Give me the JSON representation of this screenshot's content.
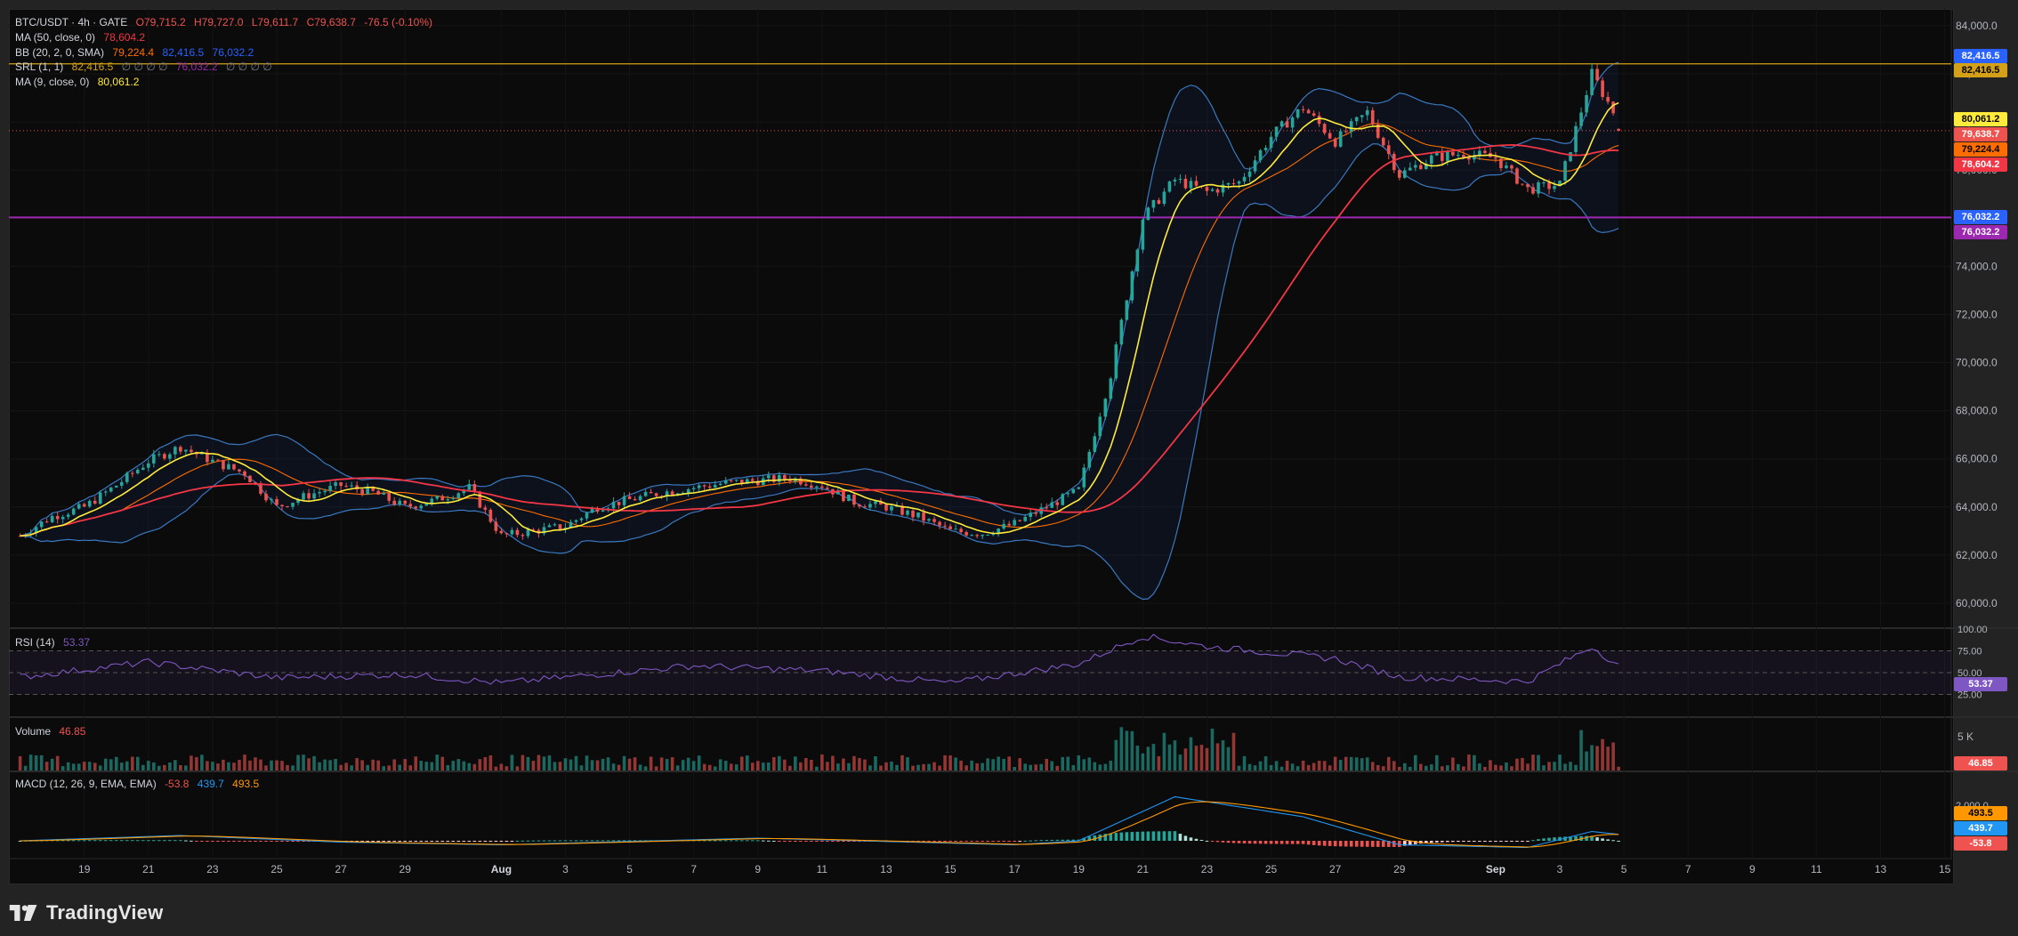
{
  "legend": {
    "symbol": "BTC/USDT · 4h · GATE",
    "o": "O79,715.2",
    "h": "H79,727.0",
    "l": "L79,611.7",
    "c": "C79,638.7",
    "chg": "-76.5 (-0.10%)",
    "ma50_label": "MA (50, close, 0)",
    "ma50_value": "78,604.2",
    "bb_label": "BB (20, 2, 0, SMA)",
    "bb_basis": "79,224.4",
    "bb_upper": "82,416.5",
    "bb_lower": "76,032.2",
    "srl_label": "SRL (1, 1)",
    "srl_upper": "82,416.5",
    "srl_zeros_a": "∅ ∅ ∅ ∅",
    "srl_lower": "76,032.2",
    "srl_zeros_b": "∅ ∅ ∅ ∅",
    "ma9_label": "MA (9, close, 0)",
    "ma9_value": "80,061.2",
    "rsi_label": "RSI (14)",
    "rsi_value": "53.37",
    "vol_label": "Volume",
    "vol_value": "46.85",
    "macd_label": "MACD (12, 26, 9, EMA, EMA)",
    "macd_hist": "-53.8",
    "macd_line": "439.7",
    "macd_signal": "493.5"
  },
  "colors": {
    "up": "#26a69a",
    "down": "#ef5350",
    "ma9": "#ffeb3b",
    "ma50": "#f23645",
    "bb_basis": "#ff6d00",
    "bb_band": "#2962ff",
    "srl_upper": "#d4a017",
    "srl_lower": "#9c27b0",
    "rsi": "#7e57c2",
    "macd": "#2196f3",
    "signal": "#ff9800"
  },
  "price_axis": [
    "84,000.0",
    "82,000.0",
    "80,000.0",
    "78,000.0",
    "76,000.0",
    "74,000.0",
    "72,000.0",
    "70,000.0",
    "68,000.0",
    "66,000.0",
    "64,000.0",
    "62,000.0",
    "60,000.0"
  ],
  "rsi_axis": [
    "100.00",
    "75.00",
    "50.00",
    "25.00"
  ],
  "vol_axis": [
    "5 K"
  ],
  "macd_axis": [
    "2,000.0"
  ],
  "price_labels": {
    "bb_upper": "82,416.5",
    "srl_upper": "82,416.5",
    "ma9": "80,061.2",
    "last": "79,638.7",
    "basis": "79,224.4",
    "ma50": "78,604.2",
    "bb_lower": "76,032.2",
    "srl_lower": "76,032.2",
    "rsi": "53.37",
    "vol": "46.85",
    "signal": "493.5",
    "macd": "439.7",
    "hist": "-53.8"
  },
  "time_axis": [
    "19",
    "21",
    "23",
    "25",
    "27",
    "29",
    "Aug",
    "3",
    "5",
    "7",
    "9",
    "11",
    "13",
    "15",
    "17",
    "19",
    "21",
    "23",
    "25",
    "27",
    "29",
    "Sep",
    "3",
    "5",
    "7",
    "9",
    "11",
    "13",
    "15"
  ],
  "brand": "TradingView",
  "chart_data": {
    "type": "candlestick",
    "symbol": "BTC/USDT",
    "timeframe": "4h",
    "exchange": "GATE",
    "ohlc_last": {
      "open": 79715.2,
      "high": 79727.0,
      "low": 79611.7,
      "close": 79638.7
    },
    "change": -76.5,
    "change_pct": -0.1,
    "ylim": [
      59000,
      84700
    ],
    "close_path": [
      {
        "date": "Jul 17",
        "close": 62800
      },
      {
        "date": "Jul 18",
        "close": 63600
      },
      {
        "date": "Jul 19",
        "close": 64000
      },
      {
        "date": "Jul 20",
        "close": 64900
      },
      {
        "date": "Jul 21",
        "close": 65900
      },
      {
        "date": "Jul 22",
        "close": 66500
      },
      {
        "date": "Jul 23",
        "close": 65900
      },
      {
        "date": "Jul 24",
        "close": 65400
      },
      {
        "date": "Jul 25",
        "close": 64000
      },
      {
        "date": "Jul 26",
        "close": 64500
      },
      {
        "date": "Jul 27",
        "close": 64900
      },
      {
        "date": "Jul 28",
        "close": 64600
      },
      {
        "date": "Jul 29",
        "close": 64000
      },
      {
        "date": "Jul 30",
        "close": 64300
      },
      {
        "date": "Jul 31",
        "close": 64800
      },
      {
        "date": "Aug 1",
        "close": 62800
      },
      {
        "date": "Aug 2",
        "close": 63000
      },
      {
        "date": "Aug 3",
        "close": 63200
      },
      {
        "date": "Aug 4",
        "close": 64000
      },
      {
        "date": "Aug 5",
        "close": 64300
      },
      {
        "date": "Aug 6",
        "close": 64600
      },
      {
        "date": "Aug 7",
        "close": 64800
      },
      {
        "date": "Aug 8",
        "close": 65000
      },
      {
        "date": "Aug 9",
        "close": 65100
      },
      {
        "date": "Aug 10",
        "close": 65200
      },
      {
        "date": "Aug 11",
        "close": 64900
      },
      {
        "date": "Aug 12",
        "close": 64200
      },
      {
        "date": "Aug 13",
        "close": 64000
      },
      {
        "date": "Aug 14",
        "close": 63600
      },
      {
        "date": "Aug 15",
        "close": 63000
      },
      {
        "date": "Aug 16",
        "close": 62900
      },
      {
        "date": "Aug 17",
        "close": 63300
      },
      {
        "date": "Aug 18",
        "close": 64000
      },
      {
        "date": "Aug 19",
        "close": 64700
      },
      {
        "date": "Aug 20",
        "close": 69500
      },
      {
        "date": "Aug 21",
        "close": 76000
      },
      {
        "date": "Aug 22",
        "close": 77600
      },
      {
        "date": "Aug 23",
        "close": 77100
      },
      {
        "date": "Aug 24",
        "close": 77500
      },
      {
        "date": "Aug 25",
        "close": 79400
      },
      {
        "date": "Aug 26",
        "close": 80600
      },
      {
        "date": "Aug 27",
        "close": 79200
      },
      {
        "date": "Aug 28",
        "close": 80400
      },
      {
        "date": "Aug 29",
        "close": 77800
      },
      {
        "date": "Aug 30",
        "close": 78500
      },
      {
        "date": "Aug 31",
        "close": 78700
      },
      {
        "date": "Sep 1",
        "close": 78500
      },
      {
        "date": "Sep 2",
        "close": 77200
      },
      {
        "date": "Sep 3",
        "close": 77400
      },
      {
        "date": "Sep 4",
        "close": 82000
      },
      {
        "date": "Sep 5",
        "close": 79638.7
      }
    ],
    "indicators": {
      "ma50": 78604.2,
      "bb_basis": 79224.4,
      "bb_upper": 82416.5,
      "bb_lower": 76032.2,
      "ma9": 80061.2,
      "srl_upper": 82416.5,
      "srl_lower": 76032.2,
      "rsi14": 53.37,
      "volume": 46.85,
      "macd_hist": -53.8,
      "macd": 439.7,
      "macd_signal": 493.5
    },
    "rsi_path": [
      {
        "date": "Jul 17",
        "rsi": 45
      },
      {
        "date": "Jul 21",
        "rsi": 62
      },
      {
        "date": "Jul 25",
        "rsi": 44
      },
      {
        "date": "Jul 29",
        "rsi": 48
      },
      {
        "date": "Aug 1",
        "rsi": 38
      },
      {
        "date": "Aug 7",
        "rsi": 58
      },
      {
        "date": "Aug 11",
        "rsi": 52
      },
      {
        "date": "Aug 15",
        "rsi": 38
      },
      {
        "date": "Aug 19",
        "rsi": 60
      },
      {
        "date": "Aug 21",
        "rsi": 92
      },
      {
        "date": "Aug 23",
        "rsi": 80
      },
      {
        "date": "Aug 27",
        "rsi": 66
      },
      {
        "date": "Aug 29",
        "rsi": 45
      },
      {
        "date": "Sep 2",
        "rsi": 40
      },
      {
        "date": "Sep 4",
        "rsi": 80
      },
      {
        "date": "Sep 5",
        "rsi": 53.37
      }
    ],
    "macd_path": [
      {
        "date": "Jul 17",
        "macd": 0
      },
      {
        "date": "Jul 22",
        "macd": 400
      },
      {
        "date": "Jul 27",
        "macd": -100
      },
      {
        "date": "Aug 1",
        "macd": -300
      },
      {
        "date": "Aug 9",
        "macd": 200
      },
      {
        "date": "Aug 17",
        "macd": -300
      },
      {
        "date": "Aug 19",
        "macd": 0
      },
      {
        "date": "Aug 22",
        "macd": 3300
      },
      {
        "date": "Aug 26",
        "macd": 1800
      },
      {
        "date": "Aug 29",
        "macd": -300
      },
      {
        "date": "Sep 2",
        "macd": -500
      },
      {
        "date": "Sep 4",
        "macd": 700
      },
      {
        "date": "Sep 5",
        "macd": 439.7
      }
    ]
  }
}
